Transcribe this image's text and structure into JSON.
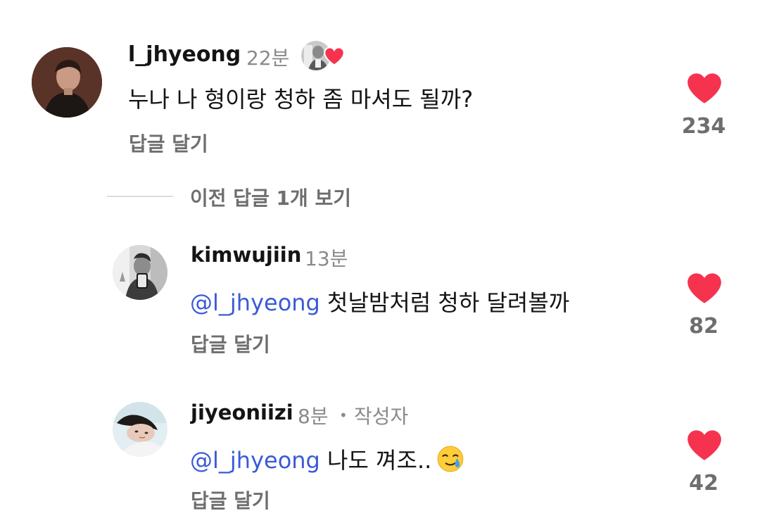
{
  "comments": [
    {
      "username": "l_jhyeong",
      "time": "22분",
      "text": "누나 나 형이랑 청하 좀 마셔도 될까?",
      "reply_label": "답글 달기",
      "likes": "234",
      "creator_liked": true
    }
  ],
  "view_previous": "이전 답글 1개 보기",
  "replies": [
    {
      "username": "kimwujiin",
      "time": "13분",
      "mention": "@l_jhyeong",
      "text": "첫날밤처럼 청하 달려볼까",
      "reply_label": "답글 달기",
      "likes": "82"
    },
    {
      "username": "jiyeoniizi",
      "time": "8분",
      "separator": "•",
      "author_badge": "작성자",
      "mention": "@l_jhyeong",
      "text": "나도 껴조..",
      "emoji": "🥲",
      "reply_label": "답글 달기",
      "likes": "42"
    }
  ],
  "colors": {
    "heart": "#f5334f",
    "mention": "#3b5ad8",
    "secondary_text": "#6e6e6e"
  }
}
